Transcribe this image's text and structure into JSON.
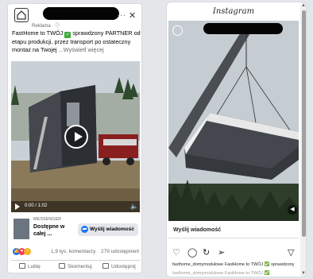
{
  "facebook": {
    "sponsored_label": "Reklama · ⓘ",
    "more_label": "···",
    "close_label": "✕",
    "post_text_1": "FastHome to TWÓJ",
    "post_text_2": "sprawdzony PARTNER od etapu produkcji, przez transport po ostateczny montaż na Twojej",
    "post_text_more": "...Wyświetl więcej",
    "check_glyph": "✓",
    "video_time": "0:00 / 1:02",
    "volume_glyph": "🔈",
    "cta_site": "MESSENGER",
    "cta_title": "Dostępne w całej ...",
    "cta_button": "Wyślij wiadomość",
    "reaction_count": "",
    "comment_count": "1,9 tys. komentarzy",
    "share_count": "279 udostępnień",
    "actions": {
      "like": "Lubię",
      "comment": "Skomentuj",
      "share": "Udostępnij"
    },
    "react_glyphs": {
      "like": "👍",
      "love": "♥",
      "wow": "•"
    }
  },
  "instagram": {
    "title": "Instagram",
    "cta_label": "Wyślij wiadomość",
    "caption": "fasthome_domymodulowe FastHome to TWÓJ ✅ sprawdzony",
    "caption_dup": "fasthome_domymodulowe FastHome to TWÓJ ✅",
    "icons": {
      "heart": "♡",
      "comment": "◯",
      "repost": "↻",
      "send": "➢",
      "save": "▽",
      "volume": "◀",
      "scroll_up": "▲",
      "scroll_down": "▼"
    }
  },
  "colors": {
    "facebook_blue": "#1877f2",
    "check_green": "#3fae39",
    "house_wall": "#3a3d42"
  }
}
